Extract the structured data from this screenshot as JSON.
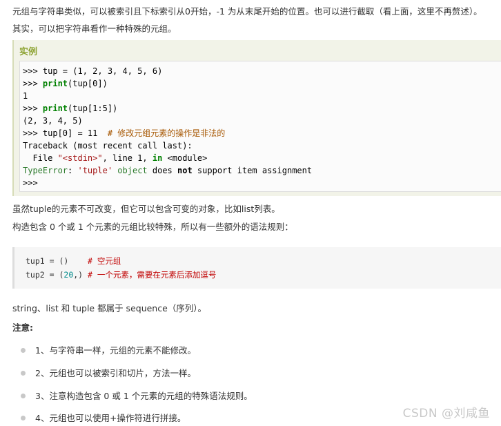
{
  "paragraphs": {
    "p1": "元组与字符串类似，可以被索引且下标索引从0开始，-1 为从末尾开始的位置。也可以进行截取（看上面，这里不再赘述）。",
    "p2": "其实，可以把字符串看作一种特殊的元组。",
    "p3": "虽然tuple的元素不可改变，但它可以包含可变的对象，比如list列表。",
    "p4": "构造包含 0 个或 1 个元素的元组比较特殊，所以有一些额外的语法规则：",
    "p5": "string、list 和 tuple 都属于 sequence（序列）。"
  },
  "example": {
    "title": "实例",
    "lines": {
      "l1_prompt": ">>> ",
      "l1_code": "tup = (1, 2, 3, 4, 5, 6)",
      "l2_prompt": ">>> ",
      "l2_kw": "print",
      "l2_rest": "(tup[0])",
      "l3": "1",
      "l4_prompt": ">>> ",
      "l4_kw": "print",
      "l4_rest": "(tup[1:5])",
      "l5": "(2, 3, 4, 5)",
      "l6_prompt": ">>> ",
      "l6_code": "tup[0] = 11  ",
      "l6_comment": "# 修改元组元素的操作是非法的",
      "l7": "Traceback (most recent call last):",
      "l8_a": "  File ",
      "l8_str": "\"<stdin>\"",
      "l8_b": ", line 1, ",
      "l8_kw": "in",
      "l8_c": " <module>",
      "l9_err": "TypeError",
      "l9_a": ": ",
      "l9_str": "'tuple'",
      "l9_b": " ",
      "l9_obj": "object",
      "l9_c": " does ",
      "l9_not": "not",
      "l9_d": " support item assignment",
      "l10": ">>>"
    }
  },
  "code2": {
    "line1_code": "tup1 = ()    ",
    "line1_comment": "# 空元组",
    "line2_a": "tup2 = (",
    "line2_num": "20",
    "line2_b": ",) ",
    "line2_comment": "# 一个元素，需要在元素后添加逗号"
  },
  "note": {
    "heading": "注意:",
    "items": [
      "1、与字符串一样，元组的元素不能修改。",
      "2、元组也可以被索引和切片，方法一样。",
      "3、注意构造包含 0 或 1 个元素的元组的特殊语法规则。",
      "4、元组也可以使用+操作符进行拼接。"
    ]
  },
  "watermark": "CSDN @刘咸鱼"
}
